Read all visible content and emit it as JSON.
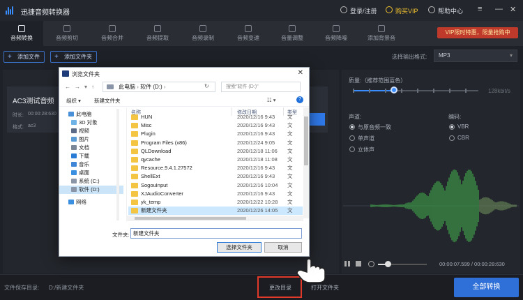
{
  "app": {
    "title": "迅捷音频转换器"
  },
  "titlebar": {
    "login": "登录/注册",
    "buy_vip": "购买VIP",
    "help": "帮助中心",
    "minimize": "—",
    "close": "✕",
    "menu": "≡"
  },
  "tabs": [
    {
      "label": "音频转换",
      "active": true
    },
    {
      "label": "音频剪切"
    },
    {
      "label": "音频合并"
    },
    {
      "label": "音频提取"
    },
    {
      "label": "音频录制"
    },
    {
      "label": "音频变速"
    },
    {
      "label": "音量调整"
    },
    {
      "label": "音频降噪"
    },
    {
      "label": "添加背景音"
    }
  ],
  "vip_banner": "VIP限时特惠，限量抢购中",
  "toolbar": {
    "add_file": "添加文件",
    "add_folder": "添加文件夹",
    "format_label": "选择输出格式:",
    "format_value": "MP3"
  },
  "filelist": {
    "card_title": "AC3测试音频",
    "duration_label": "时长:",
    "duration": "00:00:28:630",
    "format_label": "格式:",
    "format": "ac3"
  },
  "settings": {
    "quality_label": "质量:（推荐范围蓝色）",
    "bitrate_max": "128kbit/s",
    "channel_label": "声道:",
    "channel_options": [
      {
        "label": "与原音频一致",
        "selected": true
      },
      {
        "label": "单声道",
        "selected": false
      },
      {
        "label": "立体声",
        "selected": false
      }
    ],
    "encoding_label": "编码:",
    "encoding_options": [
      {
        "label": "VBR",
        "selected": true
      },
      {
        "label": "CBR",
        "selected": false
      }
    ]
  },
  "player": {
    "time": "00:00:07.599 / 00:00:28:630"
  },
  "bottom": {
    "save_dir_label": "文件保存目录:",
    "save_dir": "D:/新建文件夹",
    "change_dir": "更改目录",
    "open_folder": "打开文件夹",
    "convert_all": "全部转换"
  },
  "dialog": {
    "title": "浏览文件夹",
    "address": [
      "此电脑",
      "软件 (D:)"
    ],
    "search_placeholder": "搜索\"软件 (D:)\"",
    "organize": "组织 ▾",
    "new_folder": "新建文件夹",
    "nav": [
      {
        "label": "此电脑",
        "icon": "computer-icon",
        "color": "#4a90d9"
      },
      {
        "label": "3D 对象",
        "icon": "3d-objects-icon",
        "color": "#6fb2e6"
      },
      {
        "label": "视频",
        "icon": "video-icon",
        "color": "#5a6b88"
      },
      {
        "label": "图片",
        "icon": "pictures-icon",
        "color": "#5a9bd4"
      },
      {
        "label": "文档",
        "icon": "documents-icon",
        "color": "#7a8799"
      },
      {
        "label": "下载",
        "icon": "download-icon",
        "color": "#2a7bd6"
      },
      {
        "label": "音乐",
        "icon": "music-icon",
        "color": "#3f87d6"
      },
      {
        "label": "桌面",
        "icon": "desktop-icon",
        "color": "#3b8fe0"
      },
      {
        "label": "系统 (C:)",
        "icon": "drive-icon",
        "color": "#8a96a8"
      },
      {
        "label": "软件 (D:)",
        "icon": "drive-icon",
        "color": "#8a96a8",
        "selected": true
      },
      {
        "label": "网络",
        "icon": "network-icon",
        "color": "#3b8fe0"
      }
    ],
    "columns": [
      "名称",
      "修改日期",
      "类型"
    ],
    "files": [
      {
        "name": "HUN",
        "date": "2020/12/16 9:43",
        "type": "文"
      },
      {
        "name": "Misc",
        "date": "2020/12/16 9:43",
        "type": "文"
      },
      {
        "name": "Plugin",
        "date": "2020/12/16 9:43",
        "type": "文"
      },
      {
        "name": "Program Files (x86)",
        "date": "2020/12/24 9:05",
        "type": "文"
      },
      {
        "name": "QLDownload",
        "date": "2020/12/18 11:06",
        "type": "文"
      },
      {
        "name": "qycache",
        "date": "2020/12/18 11:08",
        "type": "文"
      },
      {
        "name": "Resource.9.4.1.27572",
        "date": "2020/12/16 9:43",
        "type": "文"
      },
      {
        "name": "ShellExt",
        "date": "2020/12/16 9:43",
        "type": "文"
      },
      {
        "name": "SogouInput",
        "date": "2020/12/16 10:04",
        "type": "文"
      },
      {
        "name": "XJAudioConverter",
        "date": "2020/12/16 9:43",
        "type": "文"
      },
      {
        "name": "yk_temp",
        "date": "2020/12/22 10:28",
        "type": "文"
      },
      {
        "name": "新建文件夹",
        "date": "2020/12/26 14:05",
        "type": "文",
        "selected": true
      }
    ],
    "filename_label": "文件夹:",
    "filename_value": "新建文件夹",
    "select_button": "选择文件夹",
    "cancel_button": "取消"
  },
  "colors": {
    "accent": "#2f78e8",
    "highlight_box": "#e23a2a",
    "wave": "#3fa34a"
  }
}
